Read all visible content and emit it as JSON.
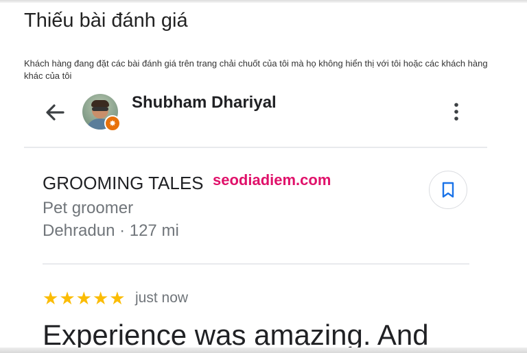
{
  "header": {
    "title": "Thiếu bài đánh giá",
    "description": "Khách hàng đang đặt các bài đánh giá trên trang chải chuốt của tôi mà họ không hiển thị với tôi hoặc các khách hàng khác của tôi"
  },
  "profile": {
    "name": "Shubham Dhariyal",
    "back_icon": "arrow-left-icon",
    "menu_icon": "more-vert-icon",
    "badge_icon": "local-guide-star-icon",
    "badge_color": "#e8710a"
  },
  "place": {
    "name": "GROOMING TALES",
    "category": "Pet groomer",
    "location": "Dehradun · 127 mi",
    "save_icon": "bookmark-icon",
    "accent_color": "#1a73e8"
  },
  "watermark": "seodiadiem.com",
  "review": {
    "rating": 5,
    "max_rating": 5,
    "star_glyph": "★",
    "star_color": "#fbbc04",
    "time": "just now",
    "text": "Experience was amazing. And"
  }
}
